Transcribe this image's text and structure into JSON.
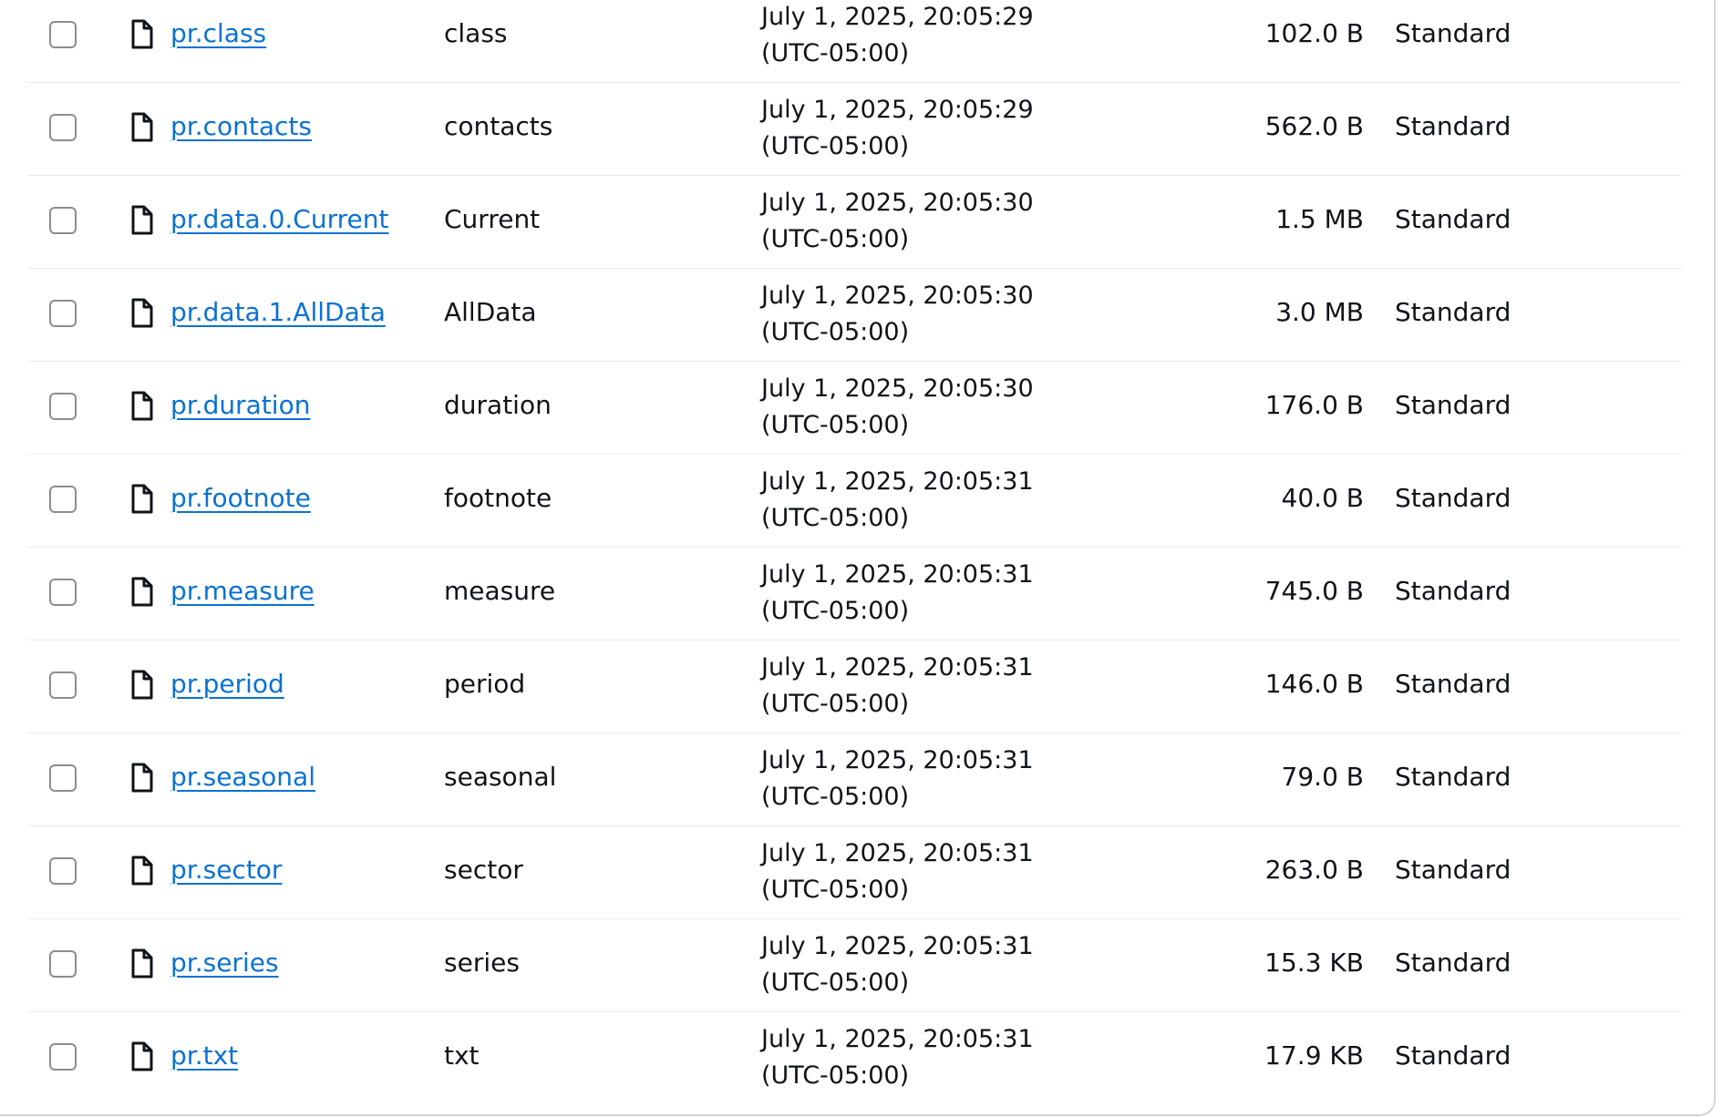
{
  "objects": [
    {
      "name": "pr.class",
      "type": "class",
      "modified_line1": "July 1, 2025, 20:05:29",
      "modified_line2": "(UTC-05:00)",
      "size": "102.0 B",
      "storage_class": "Standard"
    },
    {
      "name": "pr.contacts",
      "type": "contacts",
      "modified_line1": "July 1, 2025, 20:05:29",
      "modified_line2": "(UTC-05:00)",
      "size": "562.0 B",
      "storage_class": "Standard"
    },
    {
      "name": "pr.data.0.Current",
      "type": "Current",
      "modified_line1": "July 1, 2025, 20:05:30",
      "modified_line2": "(UTC-05:00)",
      "size": "1.5 MB",
      "storage_class": "Standard"
    },
    {
      "name": "pr.data.1.AllData",
      "type": "AllData",
      "modified_line1": "July 1, 2025, 20:05:30",
      "modified_line2": "(UTC-05:00)",
      "size": "3.0 MB",
      "storage_class": "Standard"
    },
    {
      "name": "pr.duration",
      "type": "duration",
      "modified_line1": "July 1, 2025, 20:05:30",
      "modified_line2": "(UTC-05:00)",
      "size": "176.0 B",
      "storage_class": "Standard"
    },
    {
      "name": "pr.footnote",
      "type": "footnote",
      "modified_line1": "July 1, 2025, 20:05:31",
      "modified_line2": "(UTC-05:00)",
      "size": "40.0 B",
      "storage_class": "Standard"
    },
    {
      "name": "pr.measure",
      "type": "measure",
      "modified_line1": "July 1, 2025, 20:05:31",
      "modified_line2": "(UTC-05:00)",
      "size": "745.0 B",
      "storage_class": "Standard"
    },
    {
      "name": "pr.period",
      "type": "period",
      "modified_line1": "July 1, 2025, 20:05:31",
      "modified_line2": "(UTC-05:00)",
      "size": "146.0 B",
      "storage_class": "Standard"
    },
    {
      "name": "pr.seasonal",
      "type": "seasonal",
      "modified_line1": "July 1, 2025, 20:05:31",
      "modified_line2": "(UTC-05:00)",
      "size": "79.0 B",
      "storage_class": "Standard"
    },
    {
      "name": "pr.sector",
      "type": "sector",
      "modified_line1": "July 1, 2025, 20:05:31",
      "modified_line2": "(UTC-05:00)",
      "size": "263.0 B",
      "storage_class": "Standard"
    },
    {
      "name": "pr.series",
      "type": "series",
      "modified_line1": "July 1, 2025, 20:05:31",
      "modified_line2": "(UTC-05:00)",
      "size": "15.3 KB",
      "storage_class": "Standard"
    },
    {
      "name": "pr.txt",
      "type": "txt",
      "modified_line1": "July 1, 2025, 20:05:31",
      "modified_line2": "(UTC-05:00)",
      "size": "17.9 KB",
      "storage_class": "Standard"
    }
  ],
  "icons": {
    "row_icon": "file-icon",
    "selector": "checkbox"
  },
  "colors": {
    "link": "#0972d3",
    "text": "#0f141a",
    "divider": "#e9ebed",
    "checkbox_border": "#8c8c94"
  }
}
